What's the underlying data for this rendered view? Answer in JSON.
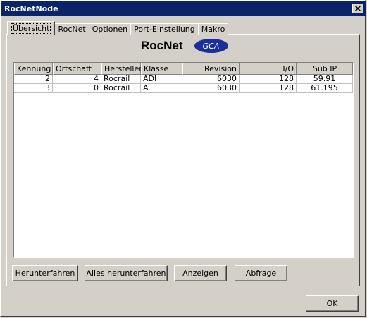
{
  "window": {
    "title": "RocNetNode"
  },
  "tabs": [
    {
      "label": "Übersicht"
    },
    {
      "label": "RocNet"
    },
    {
      "label": "Optionen"
    },
    {
      "label": "Port-Einstellung"
    },
    {
      "label": "Makro"
    }
  ],
  "brand": {
    "name": "RocNet",
    "logo_text": "GCA"
  },
  "table": {
    "columns": [
      "Kennung",
      "Ortschaft",
      "Hersteller",
      "Klasse",
      "Revision",
      "I/O",
      "Sub IP"
    ],
    "rows": [
      [
        "2",
        "4",
        "Rocrail",
        "ADI",
        "6030",
        "128",
        "59.91"
      ],
      [
        "3",
        "0",
        "Rocrail",
        "A",
        "6030",
        "128",
        "61.195"
      ]
    ]
  },
  "buttons": {
    "shutdown": "Herunterfahren",
    "shutdown_all": "Alles herunterfahren",
    "show": "Anzeigen",
    "query": "Abfrage",
    "ok": "OK"
  }
}
